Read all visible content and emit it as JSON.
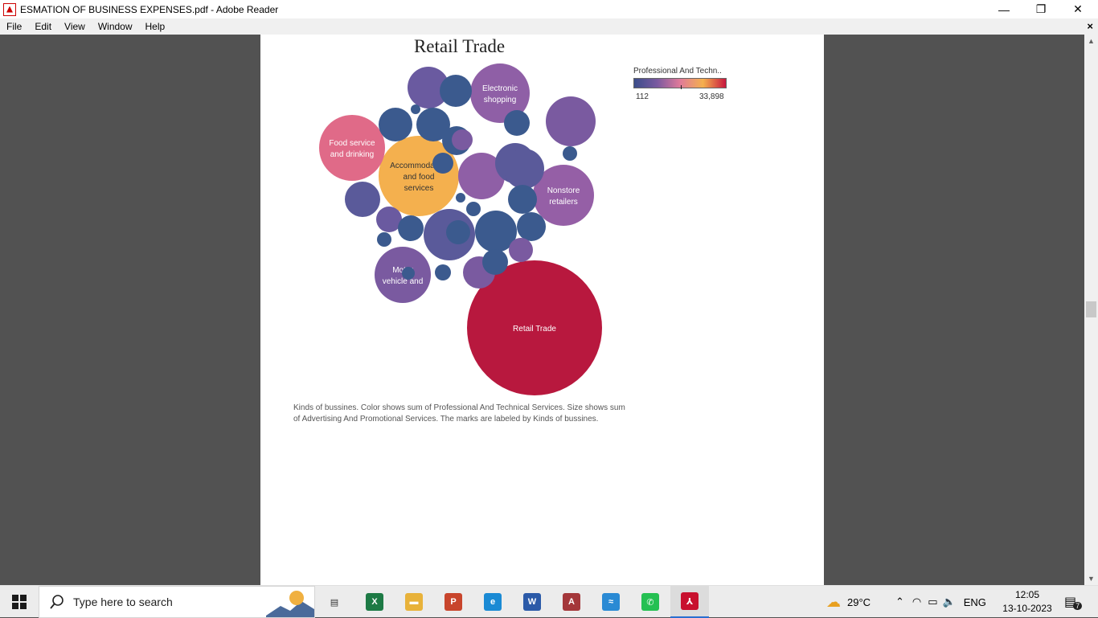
{
  "window": {
    "title": "ESMATION OF BUSINESS EXPENSES.pdf - Adobe Reader",
    "minimize": "—",
    "restore": "❐",
    "close": "✕"
  },
  "menu": {
    "items": [
      "File",
      "Edit",
      "View",
      "Window",
      "Help"
    ],
    "close": "×"
  },
  "chart": {
    "title": "Retail Trade",
    "legend_title": "Professional And Techn..",
    "legend_min": "112",
    "legend_max": "33,898",
    "caption": "Kinds of bussines.  Color shows sum of Professional And Technical Services.  Size shows sum of Advertising And Promotional Services.  The marks are labeled by Kinds of bussines."
  },
  "chart_data": {
    "type": "bubble",
    "color_scale": [
      "#3b4d8a",
      "#7a5aa0",
      "#e07a9a",
      "#f4b04e",
      "#c8173e"
    ],
    "bubbles": [
      {
        "label": "Retail Trade",
        "radius": 84,
        "color": "#b8183e"
      },
      {
        "label": "Accommodation and food services",
        "radius": 50,
        "color": "#f4b04e"
      },
      {
        "label": "Food service and drinking",
        "radius": 41,
        "color": "#e06a88"
      },
      {
        "label": "Electronic shopping",
        "radius": 37,
        "color": "#8f5fa6"
      },
      {
        "label": "Nonstore retailers",
        "radius": 38,
        "color": "#955fa6"
      },
      {
        "label": "Motor vehicle and",
        "radius": 35,
        "color": "#7a5aa0"
      },
      {
        "label": "",
        "radius": 32,
        "color": "#5a5a9a"
      },
      {
        "label": "",
        "radius": 31,
        "color": "#7a5aa0"
      },
      {
        "label": "",
        "radius": 29,
        "color": "#8f5fa6"
      },
      {
        "label": "",
        "radius": 26,
        "color": "#6a5aa0"
      },
      {
        "label": "",
        "radius": 26,
        "color": "#3b5a8e"
      },
      {
        "label": "",
        "radius": 25,
        "color": "#5a5a9a"
      },
      {
        "label": "",
        "radius": 25,
        "color": "#5a5a9a"
      },
      {
        "label": "",
        "radius": 22,
        "color": "#5a5a9a"
      },
      {
        "label": "",
        "radius": 21,
        "color": "#3b5a8e"
      },
      {
        "label": "",
        "radius": 21,
        "color": "#3b5a8e"
      },
      {
        "label": "",
        "radius": 20,
        "color": "#3b5a8e"
      },
      {
        "label": "",
        "radius": 20,
        "color": "#7a5aa0"
      },
      {
        "label": "",
        "radius": 18,
        "color": "#3b5a8e"
      },
      {
        "label": "",
        "radius": 18,
        "color": "#3b5a8e"
      },
      {
        "label": "",
        "radius": 18,
        "color": "#3b5a8e"
      },
      {
        "label": "",
        "radius": 16,
        "color": "#3b5a8e"
      },
      {
        "label": "",
        "radius": 16,
        "color": "#6a5aa0"
      },
      {
        "label": "",
        "radius": 16,
        "color": "#3b5a8e"
      },
      {
        "label": "",
        "radius": 16,
        "color": "#3b5a8e"
      },
      {
        "label": "",
        "radius": 15,
        "color": "#7a5aa0"
      },
      {
        "label": "",
        "radius": 15,
        "color": "#3b5a8e"
      },
      {
        "label": "",
        "radius": 13,
        "color": "#7a5aa0"
      },
      {
        "label": "",
        "radius": 13,
        "color": "#3b5a8e"
      },
      {
        "label": "",
        "radius": 10,
        "color": "#3b5a8e"
      },
      {
        "label": "",
        "radius": 9,
        "color": "#3b5a8e"
      },
      {
        "label": "",
        "radius": 9,
        "color": "#3b5a8e"
      },
      {
        "label": "",
        "radius": 9,
        "color": "#3b5a8e"
      },
      {
        "label": "",
        "radius": 8,
        "color": "#3b5a8e"
      },
      {
        "label": "",
        "radius": 6,
        "color": "#3b5a8e"
      },
      {
        "label": "",
        "radius": 6,
        "color": "#3b5a8e"
      }
    ]
  },
  "taskbar": {
    "search_placeholder": "Type here to search",
    "apps": [
      {
        "name": "task-view",
        "glyph": "▤",
        "color": "#333333"
      },
      {
        "name": "excel",
        "glyph": "X",
        "color": "#1d7a45"
      },
      {
        "name": "file-explorer",
        "glyph": "▬",
        "color": "#e8b23a"
      },
      {
        "name": "powerpoint",
        "glyph": "P",
        "color": "#c8452c"
      },
      {
        "name": "edge",
        "glyph": "e",
        "color": "#1a8ad4"
      },
      {
        "name": "word",
        "glyph": "W",
        "color": "#2b5aa8"
      },
      {
        "name": "access",
        "glyph": "A",
        "color": "#a4373a"
      },
      {
        "name": "feedback",
        "glyph": "≈",
        "color": "#2a8ad4"
      },
      {
        "name": "whatsapp",
        "glyph": "✆",
        "color": "#25c052"
      },
      {
        "name": "adobe-reader",
        "glyph": "⅄",
        "color": "#c8102e"
      }
    ],
    "weather": "29°C",
    "language": "ENG",
    "time": "12:05",
    "date": "13-10-2023",
    "notifications": "7"
  }
}
